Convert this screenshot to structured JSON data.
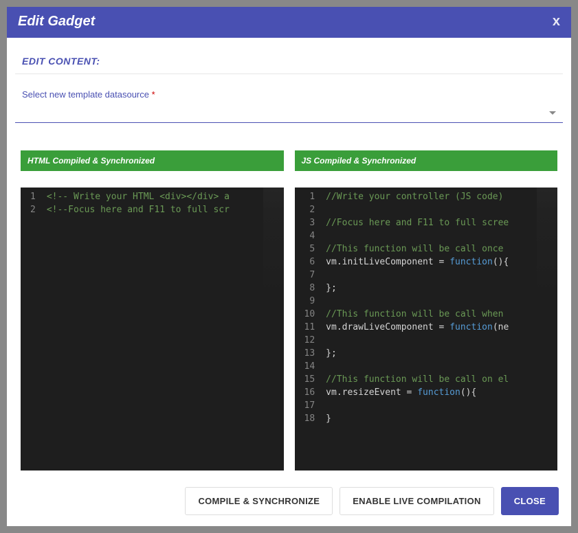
{
  "header": {
    "title": "Edit Gadget",
    "close_glyph": "x"
  },
  "section": {
    "label": "EDIT CONTENT:"
  },
  "datasource": {
    "label": "Select new template datasource",
    "required_mark": "*",
    "value": ""
  },
  "editors": {
    "html": {
      "badge": "HTML Compiled & Synchronized",
      "lines": [
        {
          "n": 1,
          "tokens": [
            {
              "cls": "tok-comment",
              "t": "<!-- Write your HTML <div></div> a"
            }
          ]
        },
        {
          "n": 2,
          "tokens": [
            {
              "cls": "tok-comment",
              "t": "<!--Focus here and F11 to full scr"
            }
          ]
        }
      ]
    },
    "js": {
      "badge": "JS Compiled & Synchronized",
      "lines": [
        {
          "n": 1,
          "tokens": [
            {
              "cls": "tok-comment",
              "t": "//Write your controller (JS code)"
            }
          ]
        },
        {
          "n": 2,
          "tokens": []
        },
        {
          "n": 3,
          "tokens": [
            {
              "cls": "tok-comment",
              "t": "//Focus here and F11 to full scree"
            }
          ]
        },
        {
          "n": 4,
          "tokens": []
        },
        {
          "n": 5,
          "tokens": [
            {
              "cls": "tok-comment",
              "t": "//This function will be call once "
            }
          ]
        },
        {
          "n": 6,
          "tokens": [
            {
              "cls": "tok-ident",
              "t": "vm"
            },
            {
              "cls": "tok-text",
              "t": "."
            },
            {
              "cls": "tok-member",
              "t": "initLiveComponent"
            },
            {
              "cls": "tok-text",
              "t": " = "
            },
            {
              "cls": "tok-keyword",
              "t": "function"
            },
            {
              "cls": "tok-text",
              "t": "(){"
            }
          ]
        },
        {
          "n": 7,
          "tokens": []
        },
        {
          "n": 8,
          "tokens": [
            {
              "cls": "tok-text",
              "t": "};"
            }
          ]
        },
        {
          "n": 9,
          "tokens": []
        },
        {
          "n": 10,
          "tokens": [
            {
              "cls": "tok-comment",
              "t": "//This function will be call when "
            }
          ]
        },
        {
          "n": 11,
          "tokens": [
            {
              "cls": "tok-ident",
              "t": "vm"
            },
            {
              "cls": "tok-text",
              "t": "."
            },
            {
              "cls": "tok-member",
              "t": "drawLiveComponent"
            },
            {
              "cls": "tok-text",
              "t": " = "
            },
            {
              "cls": "tok-keyword",
              "t": "function"
            },
            {
              "cls": "tok-text",
              "t": "(ne"
            }
          ]
        },
        {
          "n": 12,
          "tokens": []
        },
        {
          "n": 13,
          "tokens": [
            {
              "cls": "tok-text",
              "t": "};"
            }
          ]
        },
        {
          "n": 14,
          "tokens": []
        },
        {
          "n": 15,
          "tokens": [
            {
              "cls": "tok-comment",
              "t": "//This function will be call on el"
            }
          ]
        },
        {
          "n": 16,
          "tokens": [
            {
              "cls": "tok-ident",
              "t": "vm"
            },
            {
              "cls": "tok-text",
              "t": "."
            },
            {
              "cls": "tok-member",
              "t": "resizeEvent"
            },
            {
              "cls": "tok-text",
              "t": " = "
            },
            {
              "cls": "tok-keyword",
              "t": "function"
            },
            {
              "cls": "tok-text",
              "t": "(){"
            }
          ]
        },
        {
          "n": 17,
          "tokens": []
        },
        {
          "n": 18,
          "tokens": [
            {
              "cls": "tok-text",
              "t": "}"
            }
          ]
        }
      ]
    }
  },
  "footer": {
    "compile": "COMPILE & SYNCHRONIZE",
    "live": "ENABLE LIVE COMPILATION",
    "close": "CLOSE"
  }
}
